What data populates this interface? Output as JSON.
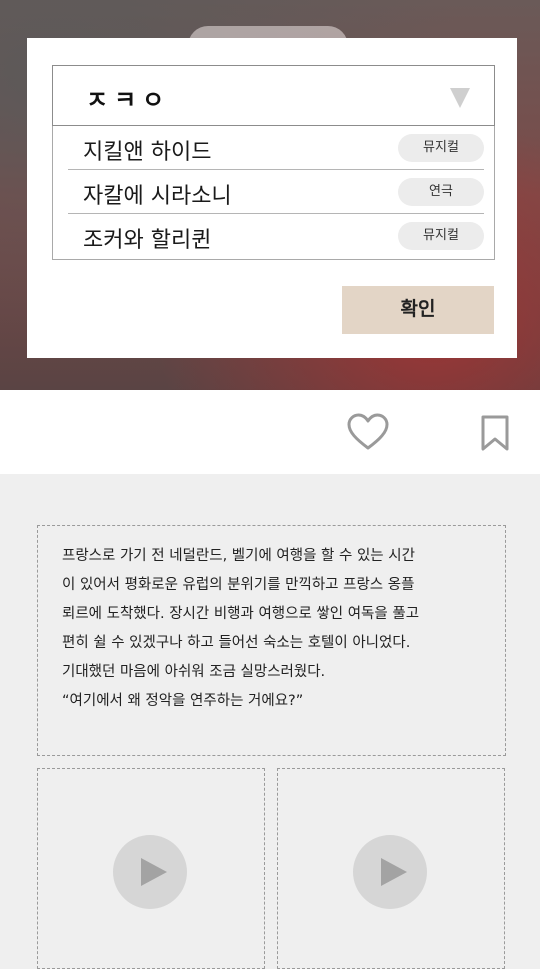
{
  "modal": {
    "select_value": "ㅈㅋㅇ",
    "options": [
      {
        "title": "지킬앤 하이드",
        "tag": "뮤지컬"
      },
      {
        "title": "자칼에 시라소니",
        "tag": "연극"
      },
      {
        "title": "조커와 할리퀸",
        "tag": "뮤지컬"
      }
    ],
    "confirm_label": "확인"
  },
  "actions": {
    "like_icon": "heart-icon",
    "bookmark_icon": "bookmark-icon"
  },
  "post": {
    "lines": [
      "프랑스로 가기 전 네덜란드, 벨기에 여행을 할 수 있는 시간",
      "이 있어서 평화로운 유럽의 분위기를 만끽하고 프랑스 옹플",
      "뢰르에 도착했다. 장시간 비행과 여행으로 쌓인 여독을 풀고",
      "편히 쉴 수 있겠구나 하고 들어선 숙소는 호텔이 아니었다.",
      "기대했던 마음에 아쉬워 조금 실망스러웠다.",
      "“여기에서 왜 정악을 연주하는 거에요?”"
    ],
    "video_icon": "play-icon"
  },
  "colors": {
    "confirm_bg": "#e3d5c6",
    "tag_bg": "#ececec",
    "page_bg": "#efefef"
  }
}
